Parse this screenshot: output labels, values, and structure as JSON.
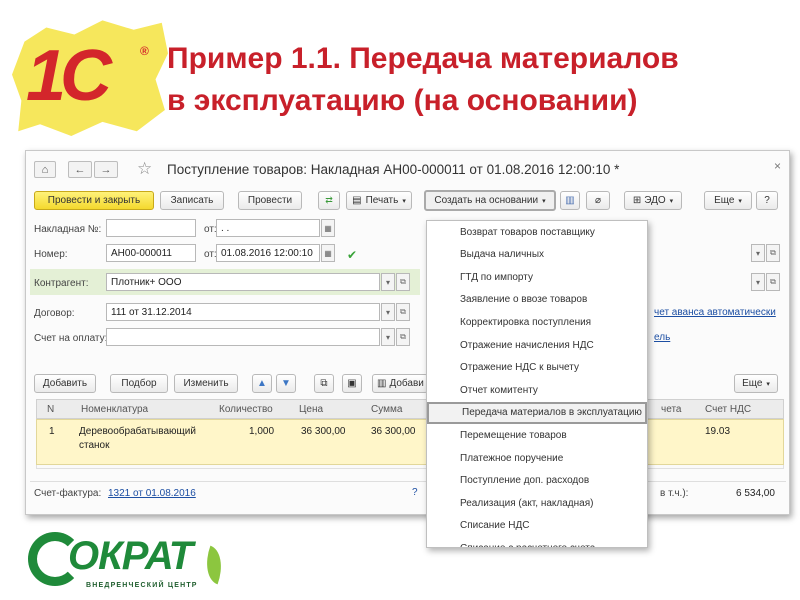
{
  "slide": {
    "title_line1": "Пример 1.1. Передача материалов",
    "title_line2": "в эксплуатацию (на основании)"
  },
  "logo_1c": {
    "text": "1С",
    "reg": "®"
  },
  "window": {
    "title": "Поступление товаров: Накладная АН00-000011 от 01.08.2016 12:00:10 *",
    "nav": {
      "home": "⌂",
      "back": "←",
      "forward": "→",
      "star": "☆",
      "close": "×"
    },
    "toolbar": {
      "post_close": "Провести и закрыть",
      "save": "Записать",
      "post": "Провести",
      "print": "Печать",
      "create_based": "Создать на основании",
      "edo": "ЭДО",
      "more": "Еще",
      "help": "?"
    },
    "form": {
      "invoice_label": "Накладная №:",
      "invoice_from": "от:",
      "invoice_date_placeholder": ". .",
      "number_label": "Номер:",
      "number_value": "АН00-000011",
      "number_from": "от:",
      "number_date": "01.08.2016 12:00:10",
      "contractor_label": "Контрагент:",
      "contractor_value": "Плотник+ ООО",
      "contract_label": "Договор:",
      "contract_value": "111 от 31.12.2014",
      "payment_label": "Счет на оплату:",
      "right_link1": "чет аванса автоматически",
      "right_link2": "ель"
    },
    "table_toolbar": {
      "add": "Добавить",
      "pick": "Подбор",
      "edit": "Изменить",
      "add2": "Добави",
      "more": "Еще"
    },
    "table": {
      "headers": [
        "N",
        "Номенклатура",
        "Количество",
        "Цена",
        "Сумма",
        "чета",
        "Счет НДС"
      ],
      "rows": [
        {
          "n": "1",
          "item_line1": "Деревообрабатывающий",
          "item_line2": "станок",
          "qty": "1,000",
          "price": "36 300,00",
          "sum": "36 300,00",
          "vat_account": "19.03"
        }
      ]
    },
    "footer": {
      "invoice_label": "Счет-фактура:",
      "invoice_link": "1321 от 01.08.2016",
      "help": "?",
      "vat_label": "в т.ч.):",
      "vat_value": "6 534,00"
    }
  },
  "menu": {
    "items": [
      "Возврат товаров поставщику",
      "Выдача наличных",
      "ГТД по импорту",
      "Заявление о ввозе товаров",
      "Корректировка поступления",
      "Отражение начисления НДС",
      "Отражение НДС к вычету",
      "Отчет комитенту",
      "Передача материалов в эксплуатацию",
      "Перемещение товаров",
      "Платежное поручение",
      "Поступление доп. расходов",
      "Реализация (акт, накладная)",
      "Списание НДС",
      "Списание с расчетного счета"
    ],
    "selected_index": 8
  },
  "logo_sokrat": {
    "word": "ОКРАТ",
    "sub": "ВНЕДРЕНЧЕСКИЙ ЦЕНТР"
  },
  "colors": {
    "title": "#c8202a",
    "primary_button": "#f4d92e",
    "contractor_band": "#e4f0d6",
    "selected_row": "#fff6c9",
    "sokrat_green": "#1f8a3a"
  }
}
